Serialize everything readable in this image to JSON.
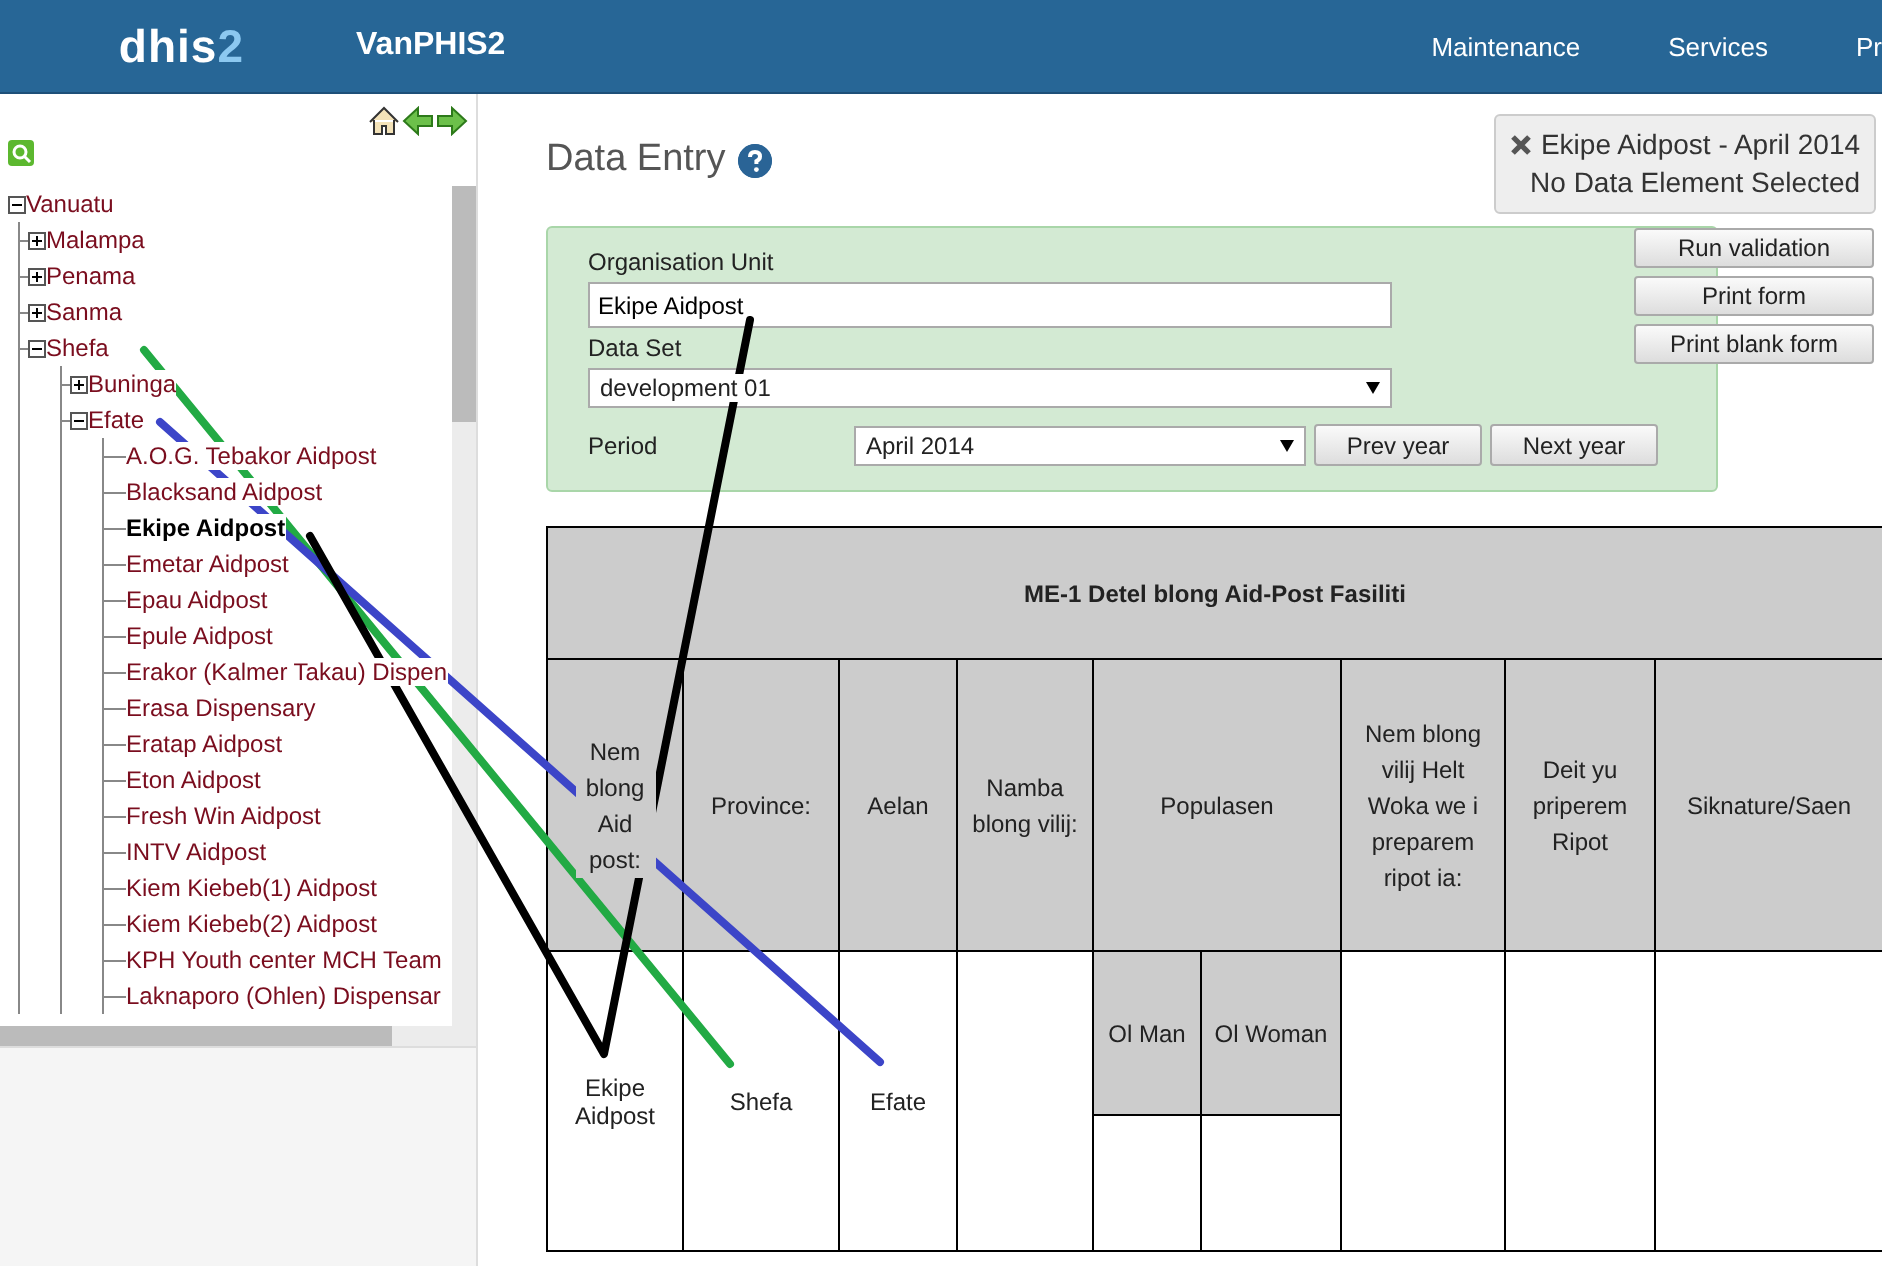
{
  "header": {
    "logo": {
      "text": "dhis",
      "accent": "2"
    },
    "app_name": "VanPHIS2",
    "nav": [
      "Maintenance",
      "Services",
      "Pr"
    ]
  },
  "tree": [
    {
      "label": "Vanuatu",
      "selected": false,
      "expanded": true,
      "children": [
        {
          "label": "Malampa",
          "selected": false,
          "expanded": false
        },
        {
          "label": "Penama",
          "selected": false,
          "expanded": false
        },
        {
          "label": "Sanma",
          "selected": false,
          "expanded": false
        },
        {
          "label": "Shefa",
          "selected": false,
          "expanded": true,
          "children": [
            {
              "label": "Buninga",
              "selected": false,
              "expanded": false
            },
            {
              "label": "Efate",
              "selected": false,
              "expanded": true,
              "children": [
                {
                  "label": "A.O.G. Tebakor Aidpost",
                  "selected": false
                },
                {
                  "label": "Blacksand Aidpost",
                  "selected": false
                },
                {
                  "label": "Ekipe Aidpost",
                  "selected": true
                },
                {
                  "label": "Emetar Aidpost",
                  "selected": false
                },
                {
                  "label": "Epau Aidpost",
                  "selected": false
                },
                {
                  "label": "Epule Aidpost",
                  "selected": false
                },
                {
                  "label": "Erakor (Kalmer Takau) Dispen",
                  "selected": false
                },
                {
                  "label": "Erasa Dispensary",
                  "selected": false
                },
                {
                  "label": "Eratap Aidpost",
                  "selected": false
                },
                {
                  "label": "Eton Aidpost",
                  "selected": false
                },
                {
                  "label": "Fresh Win Aidpost",
                  "selected": false
                },
                {
                  "label": "INTV Aidpost",
                  "selected": false
                },
                {
                  "label": "Kiem Kiebeb(1) Aidpost",
                  "selected": false
                },
                {
                  "label": "Kiem Kiebeb(2) Aidpost",
                  "selected": false
                },
                {
                  "label": "KPH Youth center MCH Team",
                  "selected": false
                },
                {
                  "label": "Laknaporo (Ohlen) Dispensar",
                  "selected": false
                }
              ]
            }
          ]
        }
      ]
    }
  ],
  "page_title": "Data Entry",
  "notice": {
    "title": "Ekipe Aidpost - April 2014",
    "subtitle": "No Data Element Selected"
  },
  "form": {
    "org_unit": {
      "label": "Organisation Unit",
      "value": "Ekipe Aidpost"
    },
    "data_set": {
      "label": "Data Set",
      "value": "development 01"
    },
    "period": {
      "label": "Period",
      "value": "April 2014"
    },
    "period_buttons": [
      "Prev year",
      "Next year"
    ]
  },
  "actions": [
    "Run validation",
    "Print form",
    "Print blank form"
  ],
  "table": {
    "title": "ME-1 Detel blong Aid-Post Fasiliti",
    "columns": [
      {
        "label": "Nem blong Aid post:"
      },
      {
        "label": "Province:"
      },
      {
        "label": "Aelan"
      },
      {
        "label": "Namba blong vilij:"
      },
      {
        "label": "Populasen",
        "sub": [
          "Ol Man",
          "Ol Woman"
        ]
      },
      {
        "label": "Nem blong vilij Helt Woka we i preparem ripot ia:"
      },
      {
        "label": "Deit yu priperem Ripot"
      },
      {
        "label": "Siknature/Saen"
      }
    ],
    "row": [
      "Ekipe Aidpost",
      "Shefa",
      "Efate"
    ]
  }
}
